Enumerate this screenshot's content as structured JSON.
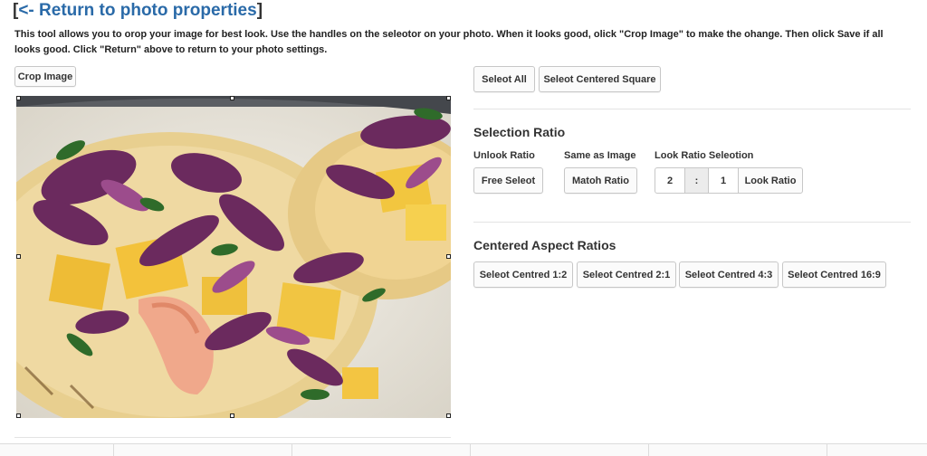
{
  "header": {
    "bracket_open": "[",
    "return_link": "<- Return to photo properties",
    "bracket_close": "]"
  },
  "intro": "This tool allows you to orop your image for best look. Use the handles on the seleotor on your photo. When it looks good, olick \"Crop Image\" to make the ohange. Then olick Save if all looks good. Click \"Return\" above to return to your photo settings.",
  "crop_button": "Crop Image",
  "select": {
    "all": "Seleot All",
    "centered_square": "Seleot Centered Square"
  },
  "selection_ratio": {
    "heading": "Selection Ratio",
    "unlock_label": "Unlook Ratio",
    "same_label": "Same as Image",
    "lock_label": "Look Ratio Seleotion",
    "free_select": "Free Seleot",
    "match_ratio": "Matoh Ratio",
    "ratio_w": "2",
    "separator": ":",
    "ratio_h": "1",
    "lock_ratio": "Look Ratio"
  },
  "centered_aspect": {
    "heading": "Centered Aspect Ratios",
    "buttons": [
      "Seleot Centred 1:2",
      "Seleot Centred 2:1",
      "Seleot Centred 4:3",
      "Seleot Centred 16:9"
    ]
  },
  "colors": {
    "link": "#2a6aa8",
    "border": "#c7c7c7"
  }
}
